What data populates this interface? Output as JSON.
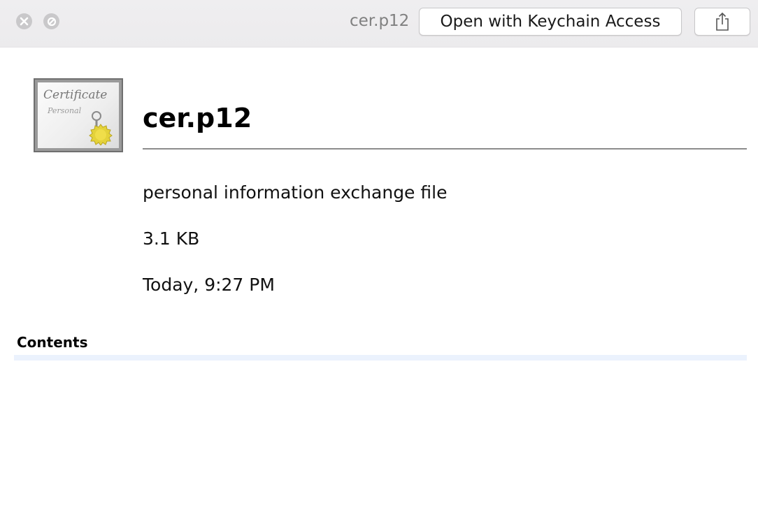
{
  "window": {
    "title": "cer.p12",
    "open_button_label": "Open with Keychain Access",
    "close_icon": "close-icon",
    "minimize_icon": "minimize-icon",
    "share_icon": "share-icon"
  },
  "file": {
    "name": "cer.p12",
    "kind": "personal information exchange file",
    "size": "3.1 KB",
    "modified": "Today, 9:27 PM",
    "icon": "certificate-icon",
    "icon_text": "Certificate",
    "icon_subtext": "Personal"
  },
  "contents": {
    "label": "Contents"
  }
}
